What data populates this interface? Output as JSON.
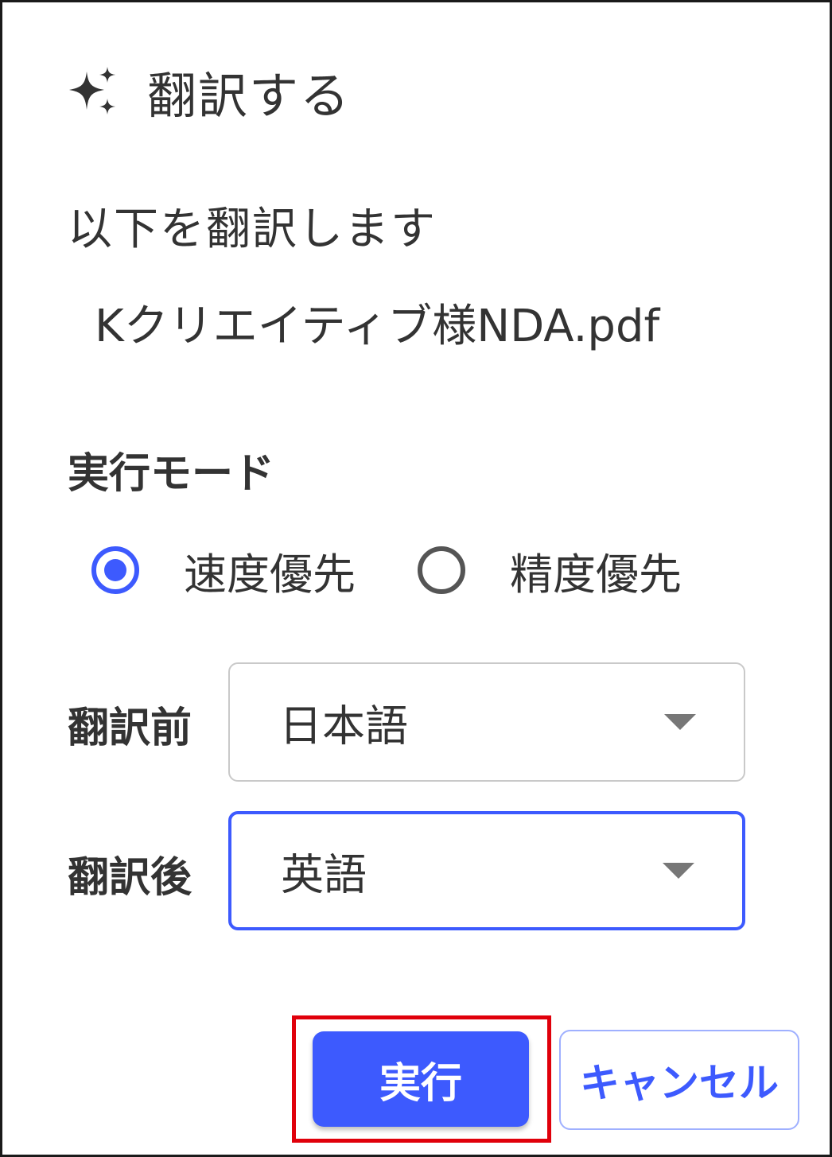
{
  "dialog": {
    "title": "翻訳する",
    "title_icon": "sparkle-icon",
    "description": "以下を翻訳します",
    "filename": "Kクリエイティブ様NDA.pdf"
  },
  "mode": {
    "label": "実行モード",
    "options": [
      {
        "label": "速度優先",
        "selected": true
      },
      {
        "label": "精度優先",
        "selected": false
      }
    ]
  },
  "source_language": {
    "label": "翻訳前",
    "value": "日本語"
  },
  "target_language": {
    "label": "翻訳後",
    "value": "英語"
  },
  "actions": {
    "execute_label": "実行",
    "cancel_label": "キャンセル"
  },
  "colors": {
    "accent": "#3d5afe",
    "highlight": "#e0000b",
    "text": "#333333"
  }
}
